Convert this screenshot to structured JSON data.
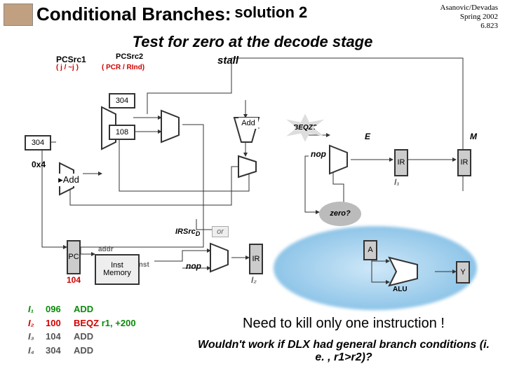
{
  "header": {
    "title_main": "Conditional Branches:",
    "title_sub": "solution 2",
    "course": {
      "line1": "Asanovic/Devadas",
      "line2": "Spring 2002",
      "line3": "6.823"
    }
  },
  "subtitle": "Test for zero at the decode stage",
  "diagram": {
    "pcsrc1": "PCSrc1",
    "pcsrc1_note": "( j / ~j )",
    "pcsrc2": "PCSrc2",
    "pcsrc2_note": "( PCR / RInd)",
    "stall": "stall",
    "const_304a": "304",
    "const_304b": "304",
    "const_108": "108",
    "const_0x4": "0x4",
    "const_104": "104",
    "add_small": "Add",
    "add_big": "Add",
    "beqz": "BEQZ?",
    "nop1": "nop",
    "nop2": "nop",
    "E": "E",
    "M": "M",
    "IR": "IR",
    "I1": "I₁",
    "I2": "I₂",
    "irsrc": "IRSrc",
    "irsrc_sub": "D",
    "or": "or",
    "zero": "zero?",
    "pc": "PC",
    "addr": "addr",
    "inst": "inst",
    "imem": "Inst",
    "imem2": "Memory",
    "A": "A",
    "ALU": "ALU",
    "Y": "Y"
  },
  "itable": {
    "rows": [
      {
        "idx": "I₁",
        "addr": "096",
        "instr": "ADD",
        "color": "#0a8a0a"
      },
      {
        "idx": "I₂",
        "addr": "100",
        "instr": "BEQZ",
        "args": "r1, +200",
        "color": "#d00000"
      },
      {
        "idx": "I₃",
        "addr": "104",
        "instr": "ADD",
        "color": "#555"
      },
      {
        "idx": "I₄",
        "addr": "304",
        "instr": "ADD",
        "color": "#555"
      }
    ]
  },
  "footer": {
    "kill": "Need to kill only one instruction !",
    "dlx": "Wouldn't work if DLX had general branch conditions (i. e. , r1>r2)?"
  }
}
